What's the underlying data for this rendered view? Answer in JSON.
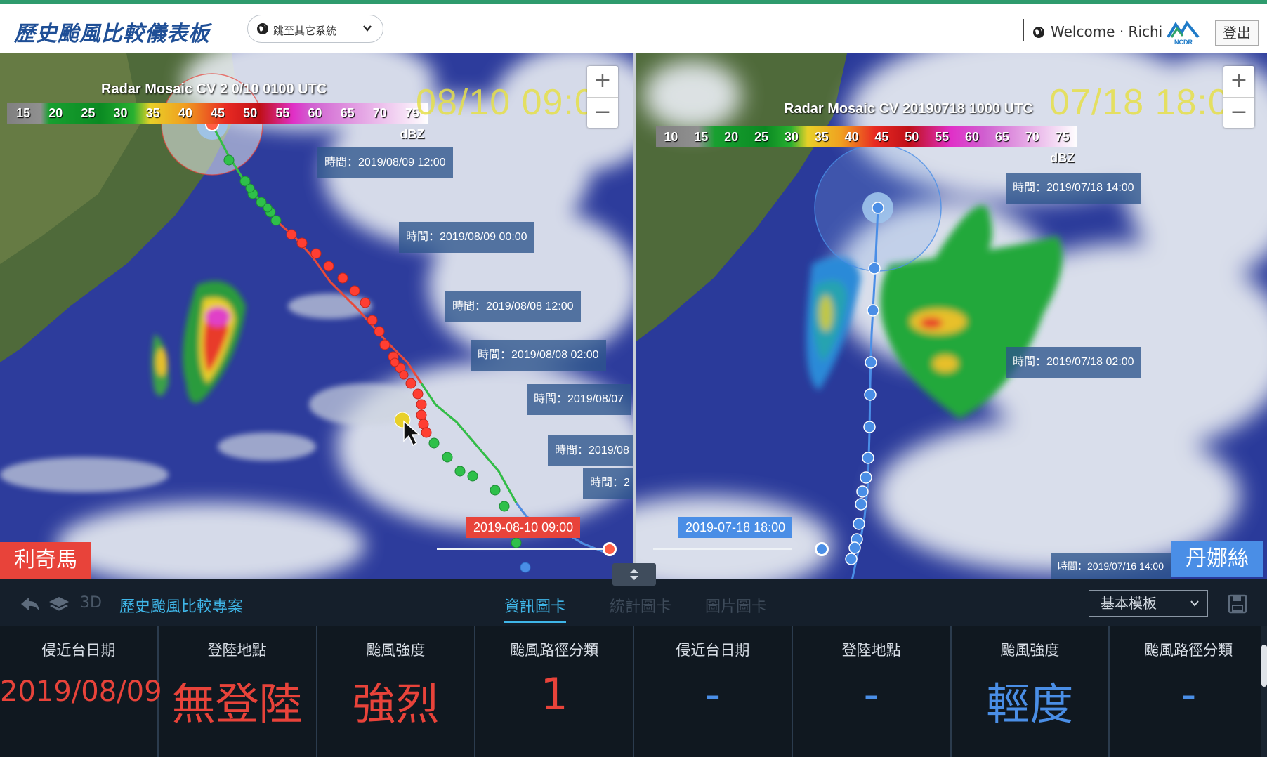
{
  "header": {
    "title": "歷史颱風比較儀表板",
    "system_select": "跳至其它系統",
    "welcome": "Welcome · Richi",
    "logo_text": "NCDR",
    "logout": "登出"
  },
  "left_map": {
    "radar_title": "Radar Mosaic CV 2 0/10 0100 UTC",
    "legend": [
      "15",
      "20",
      "25",
      "30",
      "35",
      "40",
      "45",
      "50",
      "55",
      "60",
      "65",
      "70",
      "75 dBZ"
    ],
    "big_time": "08/10 09:0",
    "tooltips": [
      "時間：2019/08/09 12:00",
      "時間：2019/08/09 00:00",
      "時間：2019/08/08 12:00",
      "時間：2019/08/08 02:00",
      "時間：2019/08/07",
      "時間：2019/08",
      "時間：2"
    ],
    "date_badge": "2019-08-10 09:00",
    "typhoon_name": "利奇馬",
    "track_color": "#e8433a",
    "accent_color": "#ff5e45"
  },
  "right_map": {
    "radar_title": "Radar Mosaic CV 20190718 1000 UTC",
    "legend": [
      "10",
      "15",
      "20",
      "25",
      "30",
      "35",
      "40",
      "45",
      "50",
      "55",
      "60",
      "65",
      "70",
      "75 dBZ"
    ],
    "big_time": "07/18 18:0",
    "tooltips": [
      "時間：2019/07/18 14:00",
      "時間：2019/07/18 02:00",
      "時間：2019/07/16 14:00"
    ],
    "date_badge": "2019-07-18 18:00",
    "typhoon_name": "丹娜絲",
    "track_color": "#4a8ee6"
  },
  "toolbar": {
    "mode_3d": "3D",
    "project": "歷史颱風比較專案",
    "tabs": [
      "資訊圖卡",
      "統計圖卡",
      "圖片圖卡"
    ],
    "active_tab": "資訊圖卡",
    "template": "基本模板"
  },
  "cards": [
    {
      "label": "侵近台日期",
      "value": "2019/08/09",
      "color": "#e8433a"
    },
    {
      "label": "登陸地點",
      "value": "無登陸",
      "color": "#e8433a"
    },
    {
      "label": "颱風強度",
      "value": "強烈",
      "color": "#e8433a"
    },
    {
      "label": "颱風路徑分類",
      "value": "1",
      "color": "#e8433a"
    },
    {
      "label": "侵近台日期",
      "value": "-",
      "color": "#4a8ee6"
    },
    {
      "label": "登陸地點",
      "value": "-",
      "color": "#4a8ee6"
    },
    {
      "label": "颱風強度",
      "value": "輕度",
      "color": "#4a8ee6"
    },
    {
      "label": "颱風路徑分類",
      "value": "-",
      "color": "#4a8ee6"
    }
  ]
}
